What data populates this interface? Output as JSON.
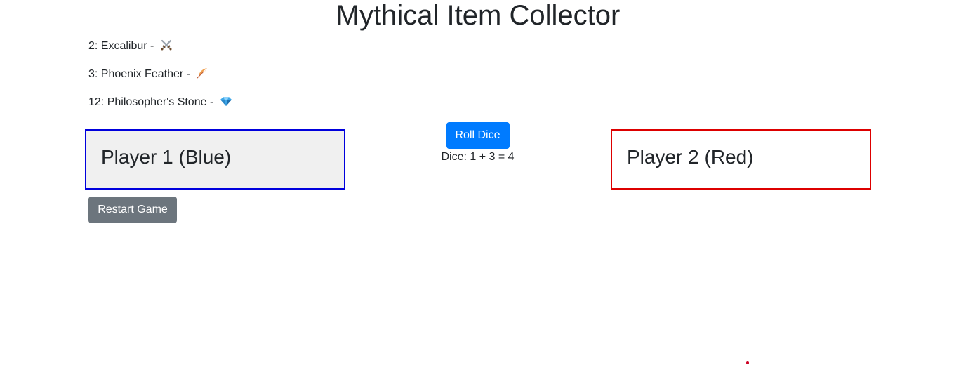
{
  "header": {
    "title": "Mythical Item Collector"
  },
  "items": [
    {
      "roll": "2",
      "name": "Excalibur",
      "label": "2: Excalibur - ",
      "icon": "crossed-swords-icon"
    },
    {
      "roll": "3",
      "name": "Phoenix Feather",
      "label": "3: Phoenix Feather - ",
      "icon": "feather-icon"
    },
    {
      "roll": "12",
      "name": "Philosopher's Stone",
      "label": "12: Philosopher's Stone - ",
      "icon": "gem-icon"
    }
  ],
  "players": {
    "player1": {
      "name": "Player 1 (Blue)",
      "color": "#0000dd",
      "active": true
    },
    "player2": {
      "name": "Player 2 (Red)",
      "color": "#dd0000",
      "active": false
    }
  },
  "controls": {
    "roll_label": "Roll Dice",
    "dice_text": "Dice: 1 + 3 = 4",
    "restart_label": "Restart Game"
  },
  "colors": {
    "primary": "#007bff",
    "secondary": "#6c757d",
    "active_player_bg": "#f0f0f0"
  }
}
